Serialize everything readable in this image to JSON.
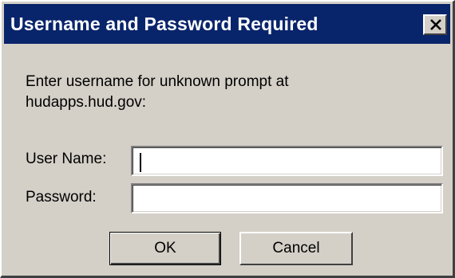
{
  "window": {
    "title": "Username and Password Required",
    "close_symbol": "close-icon"
  },
  "prompt": {
    "line1": "Enter username for unknown prompt at",
    "line2": "hudapps.hud.gov:"
  },
  "form": {
    "username_label": "User Name:",
    "username_value": "",
    "password_label": "Password:",
    "password_value": ""
  },
  "buttons": {
    "ok_label": "OK",
    "cancel_label": "Cancel"
  },
  "colors": {
    "titlebar": "#08246b",
    "dialog_face": "#d4d0c8"
  }
}
